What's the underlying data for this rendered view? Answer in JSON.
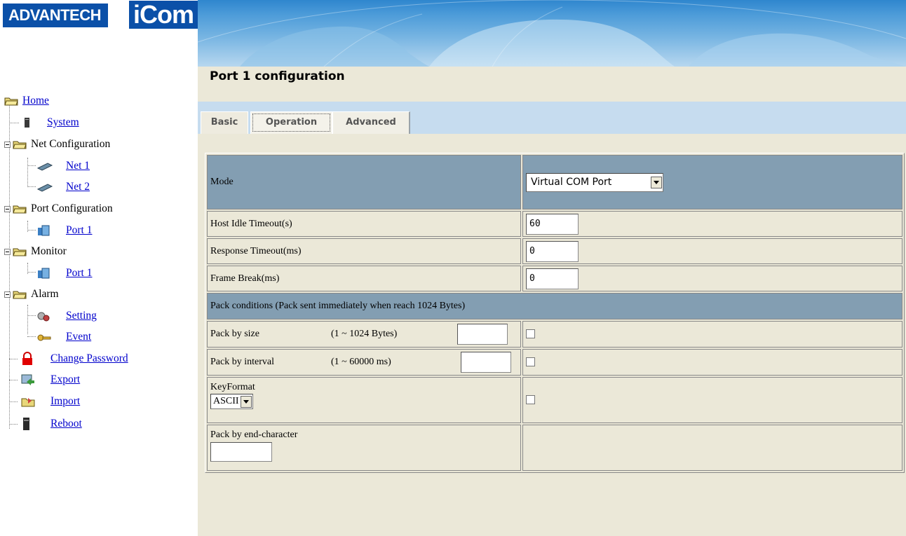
{
  "logo": {
    "brand": "ADVANTECH",
    "product": "iCom"
  },
  "page": {
    "title": "Port 1 configuration"
  },
  "tabs": [
    {
      "label": "Basic"
    },
    {
      "label": "Operation",
      "active": true
    },
    {
      "label": "Advanced"
    }
  ],
  "sidebar": {
    "home": "Home",
    "system": "System",
    "net_configuration": "Net Configuration",
    "net1": "Net 1",
    "net2": "Net 2",
    "port_configuration": "Port Configuration",
    "port_config_port1": "Port 1",
    "monitor": "Monitor",
    "monitor_port1": "Port 1",
    "alarm": "Alarm",
    "setting": "Setting",
    "event": "Event",
    "change_password": "Change Password",
    "export": "Export",
    "import": "Import",
    "reboot": "Reboot"
  },
  "form": {
    "mode_label": "Mode",
    "mode_value": "Virtual COM Port",
    "host_idle_label": "Host Idle Timeout(s)",
    "host_idle_value": "60",
    "response_timeout_label": "Response Timeout(ms)",
    "response_timeout_value": "0",
    "frame_break_label": "Frame Break(ms)",
    "frame_break_value": "0",
    "pack_conditions": "Pack conditions  (Pack sent immediately when reach 1024 Bytes)",
    "pack_by_size_label": "Pack by size",
    "pack_by_size_range": "(1 ~ 1024 Bytes)",
    "pack_by_size_value": "",
    "pack_by_interval_label": "Pack by interval",
    "pack_by_interval_range": "(1 ~ 60000 ms)",
    "pack_by_interval_value": "",
    "keyformat_label": "KeyFormat",
    "keyformat_value": "ASCII",
    "pack_end_char_label": "Pack by end-character",
    "pack_end_char_value": ""
  },
  "colors": {
    "brand_blue": "#0b50a8",
    "content_bg": "#ebe8d8",
    "tab_strip": "#c6dcef",
    "header_row": "#839eb2",
    "link": "#0000cc"
  }
}
